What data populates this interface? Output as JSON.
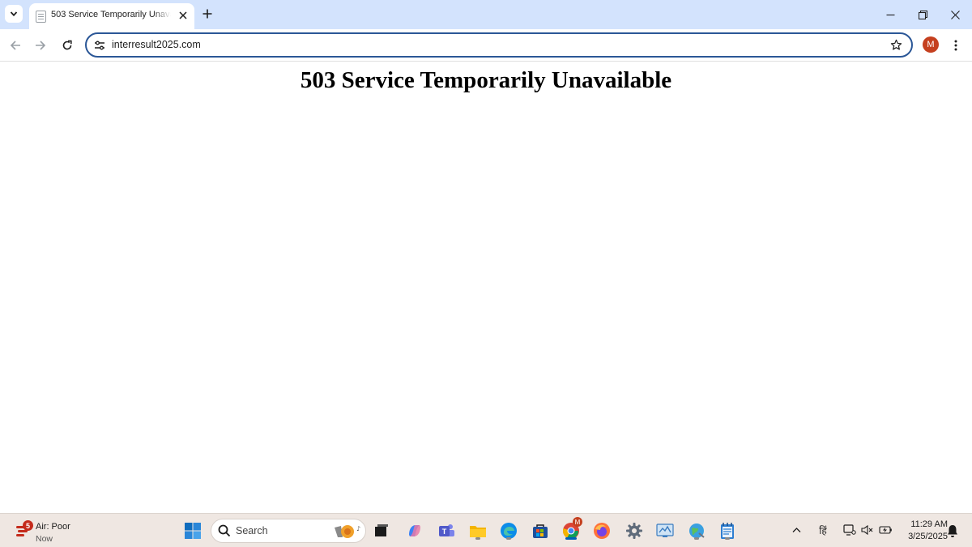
{
  "browser": {
    "tab": {
      "title": "503 Service Temporarily Unavailable"
    },
    "omnibox": {
      "url": "interresult2025.com"
    },
    "profile": {
      "initial": "M",
      "color": "#c5401f"
    }
  },
  "page": {
    "heading": "503 Service Temporarily Unavailable"
  },
  "taskbar": {
    "weather": {
      "badge": "5",
      "title": "Air: Poor",
      "subtitle": "Now"
    },
    "search": {
      "placeholder": "Search"
    },
    "chrome_badge": "M",
    "tray": {
      "language": "हिं"
    },
    "clock": {
      "time": "11:29 AM",
      "date": "3/25/2025"
    }
  },
  "colors": {
    "accent": "#2b5797",
    "tab_strip": "#d3e3fd",
    "taskbar": "#efe7e2"
  }
}
